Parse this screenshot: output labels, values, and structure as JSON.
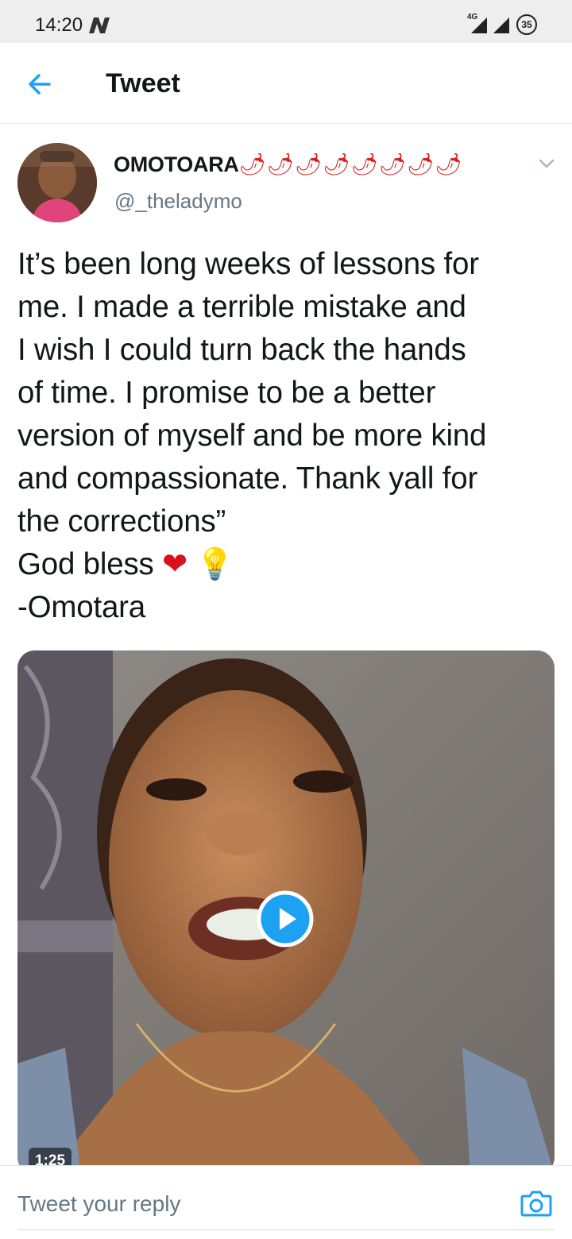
{
  "status_bar": {
    "time": "14:20",
    "network": "4G",
    "battery": "35",
    "icons": [
      "notification-n-icon",
      "signal-icon",
      "signal-icon",
      "battery-icon"
    ]
  },
  "header": {
    "title": "Tweet",
    "back_icon": "arrow-left-icon"
  },
  "tweet": {
    "display_name": "OMOTOARA",
    "name_emoji": "🌶🌶🌶🌶🌶🌶🌶🌶",
    "handle": "@_theladymo",
    "text_lines": [
      "It’s been long weeks of lessons for",
      "me. I made a terrible mistake and",
      "I wish I could turn back the hands",
      "of time. I promise to be a better",
      "version of myself and be more kind",
      "and compassionate. Thank yall for",
      "the corrections”"
    ],
    "blessing": "God bless",
    "blessing_emoji_1": "❤",
    "blessing_emoji_2": "💡",
    "signature": "-Omotara",
    "media": {
      "type": "video",
      "duration": "1:25"
    }
  },
  "reply": {
    "placeholder": "Tweet your reply"
  },
  "colors": {
    "accent": "#1da1f2",
    "text": "#14171a",
    "secondary": "#657786",
    "heart": "#d8121c"
  }
}
